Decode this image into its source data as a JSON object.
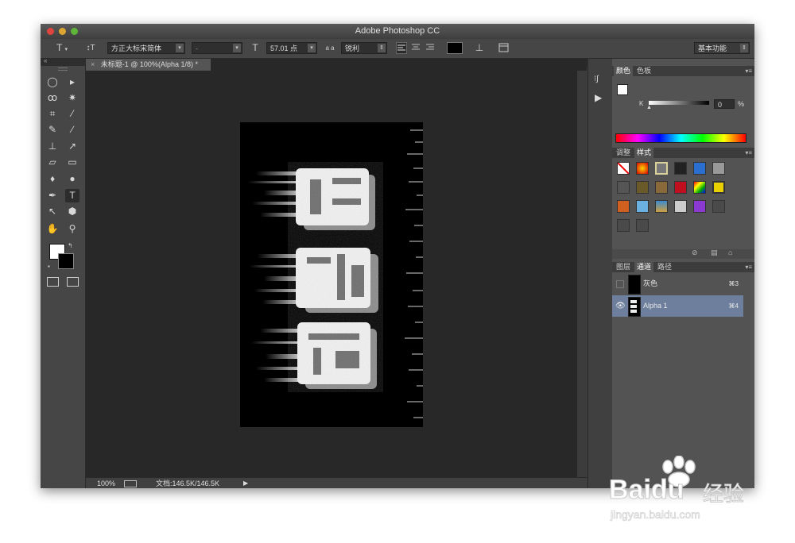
{
  "window": {
    "title": "Adobe Photoshop CC"
  },
  "options_bar": {
    "tool_icon": "T",
    "orient_icon": "↕T",
    "font_family": "方正大标宋简体",
    "font_style": "-",
    "size_icon": "T",
    "font_size": "57.01 点",
    "aa_label": "a a",
    "antialias": "锐利",
    "workspace": "基本功能",
    "text_color": "#000000"
  },
  "document": {
    "tab_title": "未标题-1 @ 100%(Alpha 1/8) *",
    "close_glyph": "×"
  },
  "status": {
    "zoom": "100%",
    "doc_info": "文档:146.5K/146.5K",
    "arrow": "▶"
  },
  "color_panel": {
    "tabs": [
      "颜色",
      "色板"
    ],
    "channel_label": "K",
    "value": "0",
    "unit": "%"
  },
  "styles_panel": {
    "tabs": [
      "调整",
      "样式"
    ]
  },
  "channels_panel": {
    "tabs": [
      "图层",
      "通道",
      "路径"
    ],
    "rows": [
      {
        "name": "灰色",
        "shortcut": "⌘3",
        "selected": false
      },
      {
        "name": "Alpha 1",
        "shortcut": "⌘4",
        "selected": true
      }
    ]
  },
  "watermark": {
    "brand": "Bai",
    "brand2": "du",
    "cn": "经验",
    "url": "jingyan.baidu.com"
  },
  "colors": {
    "panel": "#535353",
    "selected_row": "#6d7f9c",
    "canvas": "#000000",
    "baidu_blue": "#2b6be0"
  }
}
